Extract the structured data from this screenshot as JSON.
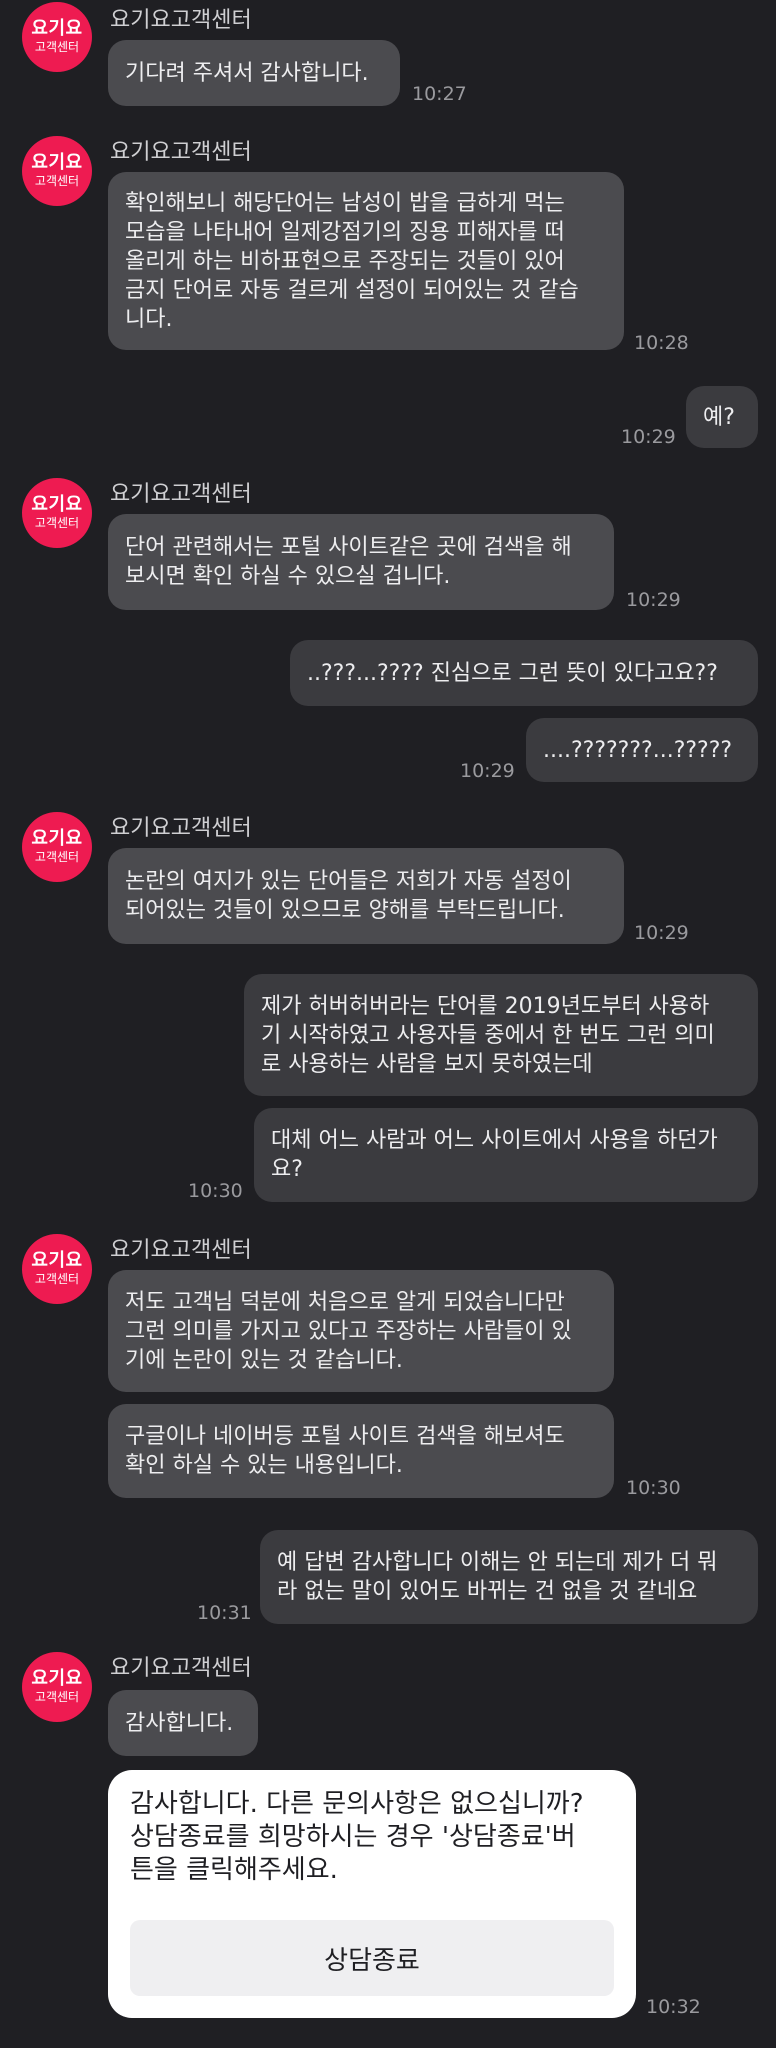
{
  "agent": {
    "name": "요기요고객센터",
    "avatar_line1": "요기요",
    "avatar_line2": "고객센터"
  },
  "messages": [
    {
      "from": "agent",
      "text": "기다려 주셔서 감사합니다.",
      "time": "10:27"
    },
    {
      "from": "agent",
      "text": "확인해보니 해당단어는 남성이 밥을 급하게 먹는\n모습을 나타내어 일제강점기의 징용 피해자를 떠\n올리게 하는 비하표현으로 주장되는 것들이 있어\n금지 단어로 자동 걸르게 설정이 되어있는 것 같습\n니다.",
      "time": "10:28"
    },
    {
      "from": "user",
      "text": "예?",
      "time": "10:29"
    },
    {
      "from": "agent",
      "text": "단어 관련해서는 포털 사이트같은 곳에 검색을 해\n보시면 확인 하실 수 있으실 겁니다.",
      "time": "10:29"
    },
    {
      "from": "user",
      "text": "..???...???? 진심으로 그런 뜻이 있다고요??",
      "time": ""
    },
    {
      "from": "user",
      "text": "....???????...?????",
      "time": "10:29"
    },
    {
      "from": "agent",
      "text": "논란의 여지가 있는 단어들은 저희가 자동 설정이\n되어있는 것들이 있으므로 양해를 부탁드립니다.",
      "time": "10:29"
    },
    {
      "from": "user",
      "text": "제가 허버허버라는 단어를 2019년도부터 사용하\n기 시작하였고 사용자들 중에서 한 번도 그런 의미\n로 사용하는 사람을 보지 못하였는데",
      "time": ""
    },
    {
      "from": "user",
      "text": "대체 어느 사람과 어느 사이트에서 사용을 하던가\n요?",
      "time": "10:30"
    },
    {
      "from": "agent",
      "text": "저도 고객님 덕분에 처음으로 알게 되었습니다만\n그런 의미를 가지고 있다고 주장하는 사람들이 있\n기에 논란이 있는 것 같습니다.",
      "time": ""
    },
    {
      "from": "agent",
      "text": "구글이나 네이버등 포털 사이트 검색을 해보셔도\n확인 하실 수 있는 내용입니다.",
      "time": "10:30"
    },
    {
      "from": "user",
      "text": "예 답변 감사합니다 이해는 안 되는데 제가 더 뭐\n라 없는 말이 있어도 바뀌는 건 없을 것 같네요",
      "time": "10:31"
    },
    {
      "from": "agent",
      "text": "감사합니다.",
      "time": ""
    }
  ],
  "end_card": {
    "text": "감사합니다. 다른 문의사항은 없으십니까?\n상담종료를 희망하시는 경우 '상담종료'버\n튼을 클릭해주세요.",
    "button_label": "상담종료",
    "time": "10:32"
  },
  "colors": {
    "background": "#1f1f23",
    "agent_bubble": "#4b4b4f",
    "user_bubble": "#3b3b3f",
    "brand": "#ee1b51",
    "card": "#ffffff"
  }
}
